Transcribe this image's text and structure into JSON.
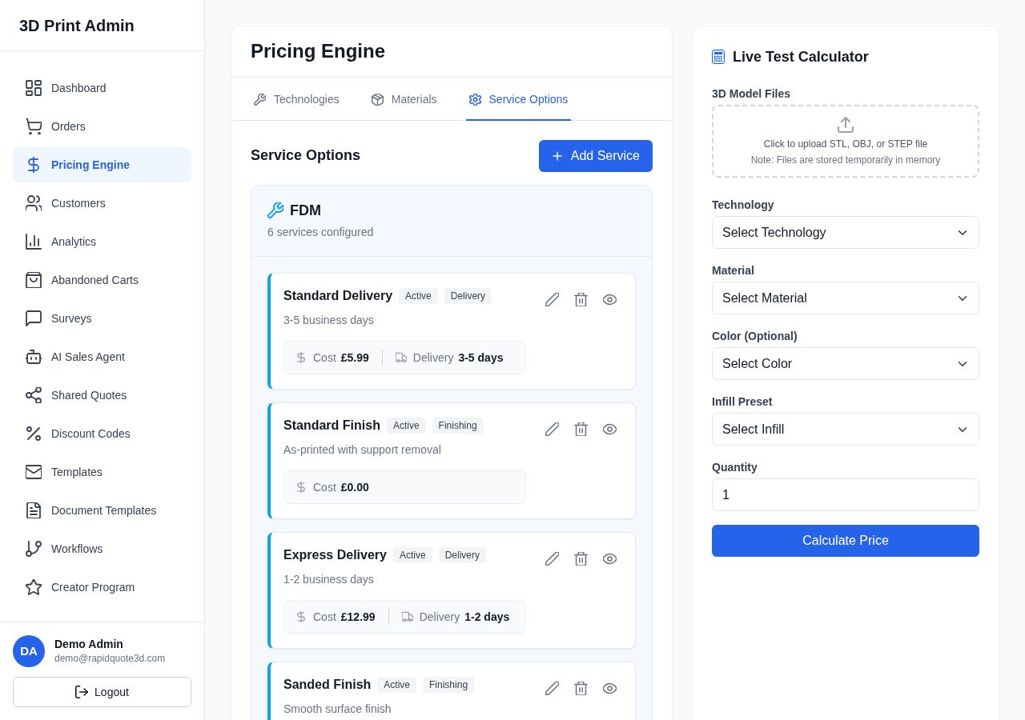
{
  "sidebar": {
    "brand": "3D Print Admin",
    "items": [
      {
        "label": "Dashboard",
        "selected": false
      },
      {
        "label": "Orders",
        "selected": false
      },
      {
        "label": "Pricing Engine",
        "selected": true
      },
      {
        "label": "Customers",
        "selected": false
      },
      {
        "label": "Analytics",
        "selected": false
      },
      {
        "label": "Abandoned Carts",
        "selected": false
      },
      {
        "label": "Surveys",
        "selected": false
      },
      {
        "label": "AI Sales Agent",
        "selected": false
      },
      {
        "label": "Shared Quotes",
        "selected": false
      },
      {
        "label": "Discount Codes",
        "selected": false
      },
      {
        "label": "Templates",
        "selected": false
      },
      {
        "label": "Document Templates",
        "selected": false
      },
      {
        "label": "Workflows",
        "selected": false
      },
      {
        "label": "Creator Program",
        "selected": false
      }
    ],
    "user": {
      "initials": "DA",
      "name": "Demo Admin",
      "email": "demo@rapidquote3d.com"
    },
    "logout": "Logout"
  },
  "main": {
    "title": "Pricing Engine",
    "tabs": [
      {
        "label": "Technologies",
        "selected": false
      },
      {
        "label": "Materials",
        "selected": false
      },
      {
        "label": "Service Options",
        "selected": true
      }
    ],
    "section_title": "Service Options",
    "add_button": "Add Service",
    "group": {
      "name": "FDM",
      "summary": "6 services configured",
      "services": [
        {
          "name": "Standard Delivery",
          "status": "Active",
          "category": "Delivery",
          "description": "3-5 business days",
          "stats": [
            {
              "kind": "cost",
              "label": "Cost",
              "value": "£5.99"
            },
            {
              "kind": "delivery",
              "label": "Delivery",
              "value": "3-5 days"
            }
          ]
        },
        {
          "name": "Standard Finish",
          "status": "Active",
          "category": "Finishing",
          "description": "As-printed with support removal",
          "stats": [
            {
              "kind": "cost",
              "label": "Cost",
              "value": "£0.00"
            }
          ]
        },
        {
          "name": "Express Delivery",
          "status": "Active",
          "category": "Delivery",
          "description": "1-2 business days",
          "stats": [
            {
              "kind": "cost",
              "label": "Cost",
              "value": "£12.99"
            },
            {
              "kind": "delivery",
              "label": "Delivery",
              "value": "1-2 days"
            }
          ]
        },
        {
          "name": "Sanded Finish",
          "status": "Active",
          "category": "Finishing",
          "description": "Smooth surface finish"
        }
      ]
    }
  },
  "calculator": {
    "title": "Live Test Calculator",
    "upload": {
      "label": "3D Model Files",
      "prompt": "Click to upload STL, OBJ, or STEP file",
      "note": "Note: Files are stored temporarily in memory"
    },
    "fields": [
      {
        "kind": "select",
        "label": "Technology",
        "value": "Select Technology"
      },
      {
        "kind": "select",
        "label": "Material",
        "value": "Select Material"
      },
      {
        "kind": "select",
        "label": "Color (Optional)",
        "value": "Select Color"
      },
      {
        "kind": "select",
        "label": "Infill Preset",
        "value": "Select Infill"
      },
      {
        "kind": "number",
        "label": "Quantity",
        "value": "1"
      }
    ],
    "button": "Calculate Price"
  }
}
